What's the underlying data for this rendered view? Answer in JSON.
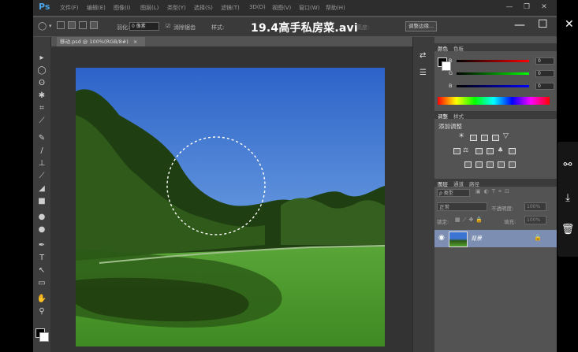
{
  "app": {
    "logo": "Ps"
  },
  "menu": [
    {
      "label": "文件(F)"
    },
    {
      "label": "编辑(E)"
    },
    {
      "label": "图像(I)"
    },
    {
      "label": "图层(L)"
    },
    {
      "label": "类型(Y)"
    },
    {
      "label": "选择(S)"
    },
    {
      "label": "滤镜(T)"
    },
    {
      "label": "3D(D)"
    },
    {
      "label": "视图(V)"
    },
    {
      "label": "窗口(W)"
    },
    {
      "label": "帮助(H)"
    }
  ],
  "options": {
    "feather_label": "羽化:",
    "feather_value": "0 像素",
    "antialias_label": "消除锯齿",
    "style_label": "样式:",
    "height_label": "高度:",
    "refine_edge_button": "调整边缘..."
  },
  "video": {
    "title": "19.4高手私房菜.avi"
  },
  "document": {
    "tab_label": "移动.psd @ 100%(RGB/8#)",
    "tab_close": "×"
  },
  "color_panel": {
    "tabs": [
      "颜色",
      "色板"
    ],
    "channels": [
      {
        "label": "R",
        "value": "0",
        "color": "#d00000"
      },
      {
        "label": "G",
        "value": "0",
        "color": "#00b000"
      },
      {
        "label": "B",
        "value": "0",
        "color": "#2020d0"
      }
    ]
  },
  "adjustments_panel": {
    "tabs": [
      "调整",
      "样式"
    ],
    "title": "添加调整"
  },
  "layers_panel": {
    "tabs": [
      "图层",
      "通道",
      "路径"
    ],
    "filter_label": "ρ 类型",
    "blend_mode": "正常",
    "opacity_label": "不透明度:",
    "opacity_value": "100%",
    "lock_label": "锁定:",
    "fill_label": "填充:",
    "fill_value": "100%",
    "layers": [
      {
        "name": "背景"
      }
    ]
  },
  "window_controls": {
    "minimize": "—",
    "restore": "❐",
    "close": "✕"
  },
  "overlay_controls": {
    "minimize": "—",
    "maximize": "☐",
    "close": "✕"
  },
  "side_actions": [
    "share-icon",
    "download-icon",
    "delete-icon"
  ],
  "colors": {
    "accent_blue": "#4aa3e6",
    "layer_selected": "#7c8fb2"
  }
}
